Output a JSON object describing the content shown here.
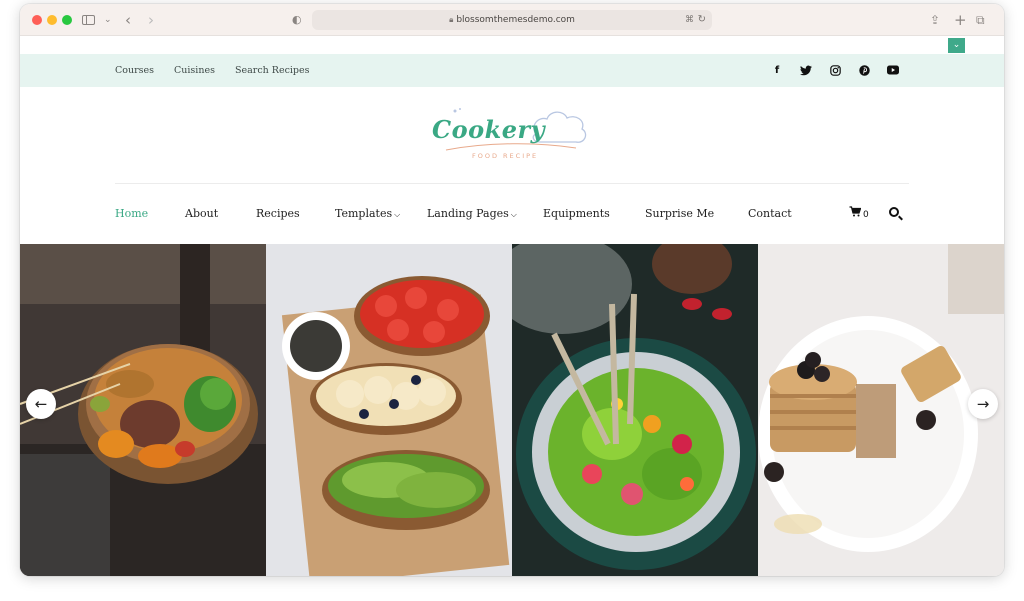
{
  "browser": {
    "url": "blossomthemesdemo.com"
  },
  "topbar": {
    "links": [
      "Courses",
      "Cuisines",
      "Search Recipes"
    ],
    "social_icons": [
      "facebook-icon",
      "twitter-icon",
      "instagram-icon",
      "pinterest-icon",
      "youtube-icon"
    ],
    "accent": "#3fa98a"
  },
  "logo": {
    "wordmark": "Cookery",
    "tagline": "FOOD RECIPE",
    "color": "#3aa884"
  },
  "nav": {
    "items": [
      {
        "label": "Home",
        "active": true
      },
      {
        "label": "About"
      },
      {
        "label": "Recipes"
      },
      {
        "label": "Templates",
        "dropdown": true
      },
      {
        "label": "Landing Pages",
        "dropdown": true
      },
      {
        "label": "Equipments"
      },
      {
        "label": "Surprise Me"
      },
      {
        "label": "Contact"
      }
    ],
    "cart_count": "0"
  },
  "slider": {
    "slides": [
      "grain-bowl-photo",
      "toast-platter-photo",
      "salad-plate-photo",
      "pancake-stack-photo"
    ]
  }
}
